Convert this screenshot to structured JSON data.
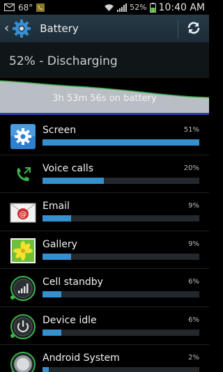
{
  "status_bar": {
    "temperature": "68°",
    "battery_percent": "52%",
    "time": "10:40 AM"
  },
  "action_bar": {
    "title": "Battery"
  },
  "summary": {
    "status_text": "52% - Discharging"
  },
  "graph": {
    "duration_label": "3h 53m 56s on battery"
  },
  "usage": [
    {
      "name": "Screen",
      "percent_label": "51%",
      "level": 1.0,
      "icon": "screen-settings-icon"
    },
    {
      "name": "Voice calls",
      "percent_label": "20%",
      "level": 0.39,
      "icon": "phone-handset-icon"
    },
    {
      "name": "Email",
      "percent_label": "9%",
      "level": 0.18,
      "icon": "email-icon"
    },
    {
      "name": "Gallery",
      "percent_label": "9%",
      "level": 0.18,
      "icon": "gallery-icon"
    },
    {
      "name": "Cell standby",
      "percent_label": "6%",
      "level": 0.12,
      "icon": "cell-signal-icon"
    },
    {
      "name": "Device idle",
      "percent_label": "6%",
      "level": 0.12,
      "icon": "power-icon"
    },
    {
      "name": "Android System",
      "percent_label": "2%",
      "level": 0.04,
      "icon": "android-system-icon"
    }
  ],
  "colors": {
    "bar_fill": "#3590d0",
    "graph_line": "#3aa84a",
    "graph_fill": "#b8bec3",
    "action_bar": "#233440"
  }
}
